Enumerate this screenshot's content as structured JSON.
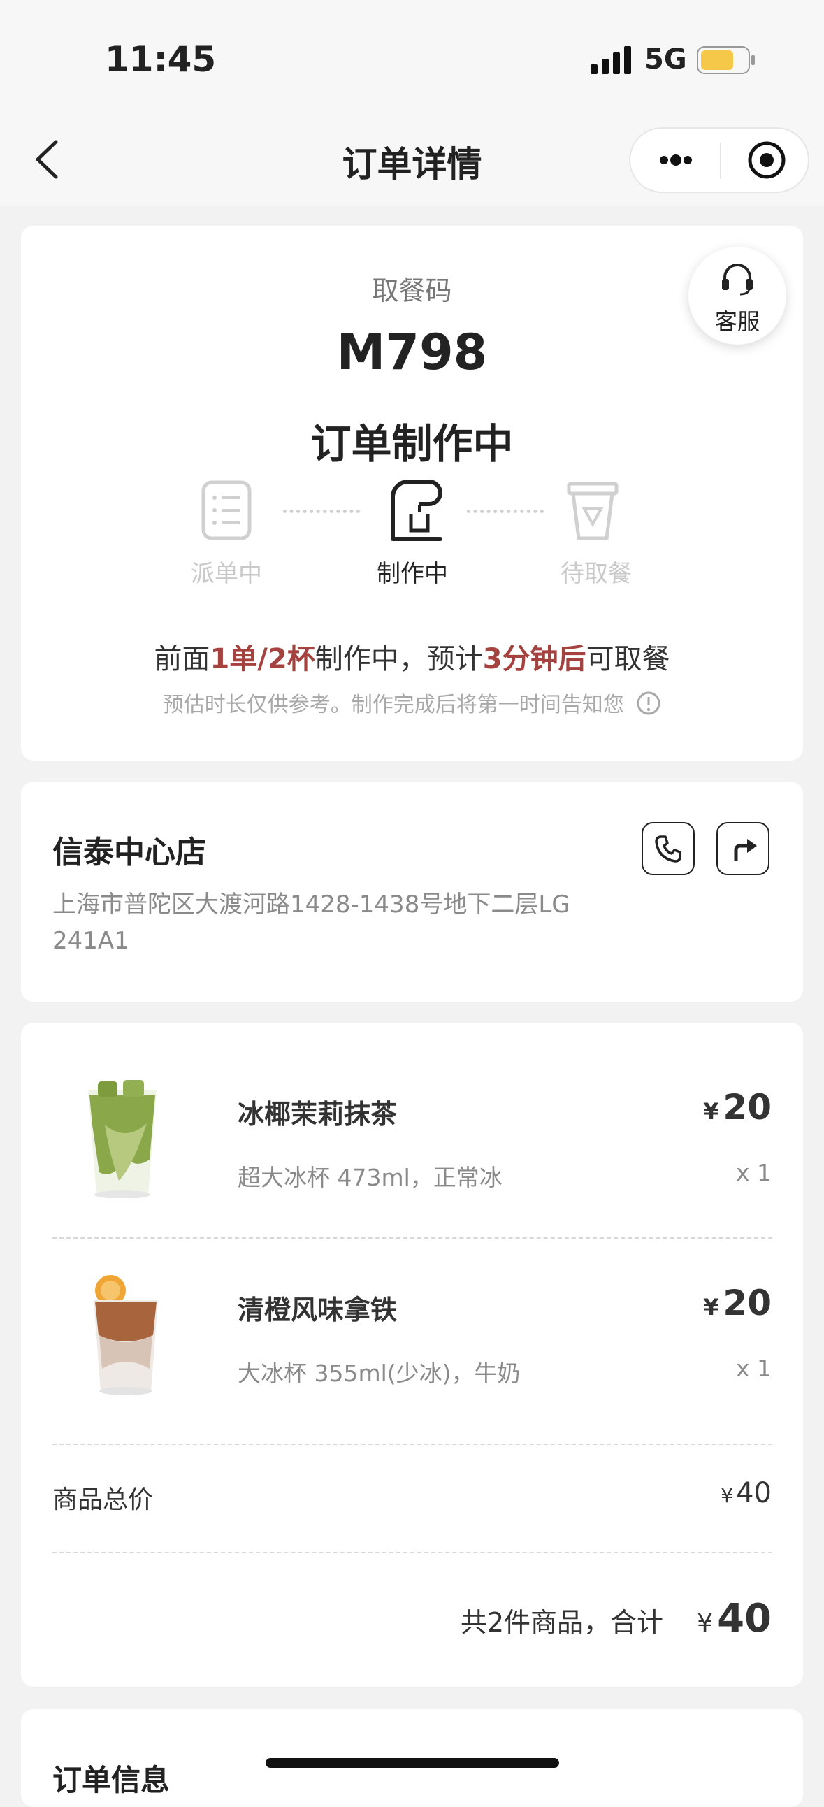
{
  "status_bar": {
    "time": "11:45",
    "network": "5G",
    "battery_color": "#f5c84a"
  },
  "nav": {
    "title": "订单详情"
  },
  "pickup": {
    "code_label": "取餐码",
    "code": "M798",
    "status": "订单制作中",
    "service_label": "客服",
    "steps": [
      {
        "label": "派单中",
        "icon": "order-list-icon",
        "active": false
      },
      {
        "label": "制作中",
        "icon": "coffee-machine-icon",
        "active": true
      },
      {
        "label": "待取餐",
        "icon": "cup-icon",
        "active": false
      }
    ],
    "queue_text": {
      "p1": "前面",
      "p2": "1单/2杯",
      "p3": "制作中，预计",
      "p4": "3分钟后",
      "p5": "可取餐"
    },
    "note": "预估时长仅供参考。制作完成后将第一时间告知您"
  },
  "store": {
    "name": "信泰中心店",
    "address_line1": "上海市普陀区大渡河路1428-1438号地下二层LG",
    "address_line2": "241A1"
  },
  "items": [
    {
      "name": "冰椰茉莉抹茶",
      "spec": "超大冰杯 473ml，正常冰",
      "currency": "¥",
      "price": "20",
      "qty": "x 1"
    },
    {
      "name": "清橙风味拿铁",
      "spec": "大冰杯 355ml(少冰)，牛奶",
      "currency": "¥",
      "price": "20",
      "qty": "x 1"
    }
  ],
  "summary": {
    "subtotal_label": "商品总价",
    "subtotal_currency": "¥",
    "subtotal_value": "40",
    "total_label": "共2件商品，合计",
    "total_currency": "¥",
    "total_value": "40"
  },
  "order_info": {
    "title": "订单信息"
  },
  "colors": {
    "accent_red": "#a3423e",
    "text_dark": "#222222",
    "text_gray": "#8a8a8a"
  }
}
